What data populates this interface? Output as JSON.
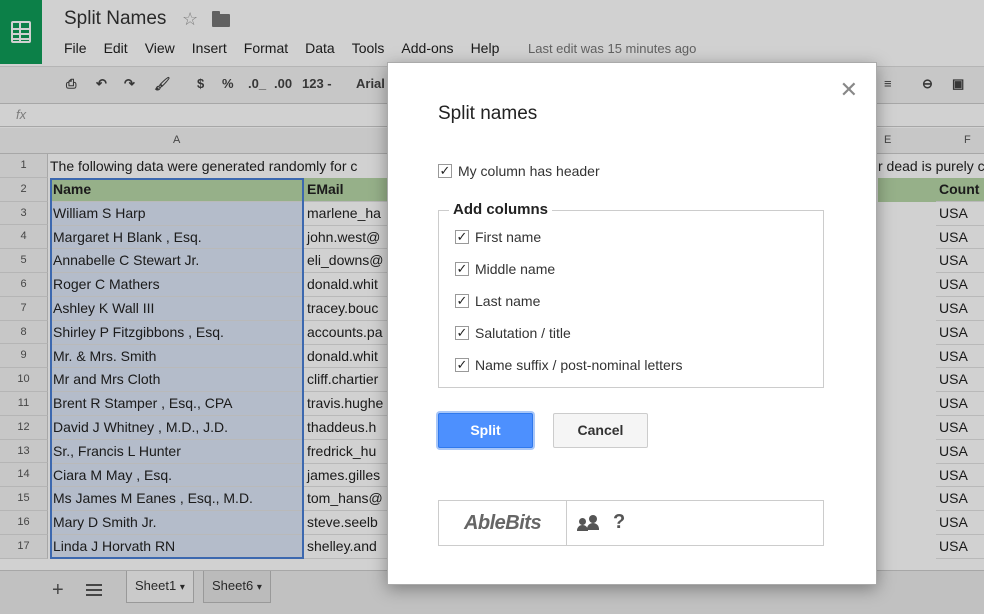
{
  "app": {
    "doc_title": "Split Names",
    "last_edit": "Last edit was 15 minutes ago"
  },
  "menu": [
    "File",
    "Edit",
    "View",
    "Insert",
    "Format",
    "Data",
    "Tools",
    "Add-ons",
    "Help"
  ],
  "toolbar": {
    "currency": "$",
    "percent": "%",
    "dec_less": ".0_",
    ".dec_more": ".00",
    "dec_more": ".00",
    "number_format": "123 -",
    "font": "Arial"
  },
  "formula_bar": {
    "fx_label": "fx"
  },
  "grid": {
    "col_headers": [
      "A",
      "E",
      "F"
    ],
    "row_numbers": [
      "1",
      "2",
      "3",
      "4",
      "5",
      "6",
      "7",
      "8",
      "9",
      "10",
      "11",
      "12",
      "13",
      "14",
      "15",
      "16",
      "17"
    ],
    "row1_text": "The following data were generated randomly for c",
    "row1_right": "r dead is purely c",
    "col_a": [
      "Name",
      "William S Harp",
      "Margaret H Blank , Esq.",
      "Annabelle C Stewart Jr.",
      "Roger C Mathers",
      "Ashley K Wall III",
      "Shirley P Fitzgibbons , Esq.",
      "Mr. & Mrs. Smith",
      "Mr and Mrs Cloth",
      "Brent R Stamper , Esq., CPA",
      "David J Whitney , M.D., J.D.",
      "Sr., Francis L Hunter",
      "Ciara M May , Esq.",
      "Ms James M Eanes , Esq., M.D.",
      "Mary D Smith Jr.",
      "Linda J Horvath RN"
    ],
    "col_b": [
      "EMail",
      "marlene_ha",
      "john.west@",
      "eli_downs@",
      "donald.whit",
      "tracey.bouc",
      "accounts.pa",
      "donald.whit",
      "cliff.chartier",
      "travis.hughe",
      "thaddeus.h",
      "fredrick_hu",
      "james.gilles",
      "tom_hans@",
      "steve.seelb",
      "shelley.and"
    ],
    "col_e_head": "e",
    "col_f": [
      "Count",
      "USA",
      "USA",
      "USA",
      "USA",
      "USA",
      "USA",
      "USA",
      "USA",
      "USA",
      "USA",
      "USA",
      "USA",
      "USA",
      "USA",
      "USA"
    ]
  },
  "sheets": {
    "tabs": [
      "Sheet1",
      "Sheet6"
    ],
    "active": "Sheet1"
  },
  "dialog": {
    "title": "Split names",
    "header_checkbox": {
      "label": "My column has header",
      "checked": true
    },
    "group_label": "Add columns",
    "columns": [
      {
        "label": "First name",
        "checked": true
      },
      {
        "label": "Middle name",
        "checked": true
      },
      {
        "label": "Last name",
        "checked": true
      },
      {
        "label": "Salutation / title",
        "checked": true
      },
      {
        "label": "Name suffix / post-nominal letters",
        "checked": true
      }
    ],
    "split_label": "Split",
    "cancel_label": "Cancel",
    "brand": "AbleBits",
    "help_label": "?"
  },
  "colors": {
    "sheets_green": "#0f9d58",
    "header_fill": "#b7d7a8",
    "selection_fill": "#dce6f7",
    "primary_button": "#4d90fe"
  }
}
